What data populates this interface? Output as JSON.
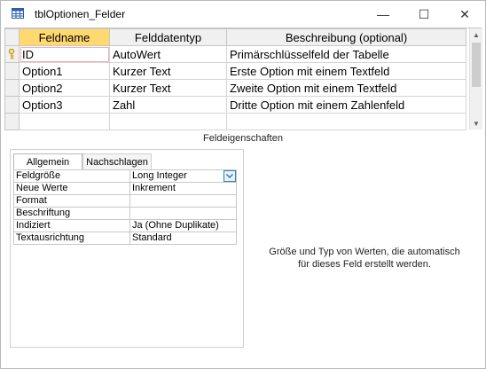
{
  "window": {
    "title": "tblOptionen_Felder",
    "controls": {
      "minimize": "—",
      "maximize": "☐",
      "close": "✕"
    }
  },
  "grid": {
    "headers": [
      "Feldname",
      "Felddatentyp",
      "Beschreibung (optional)"
    ],
    "rows": [
      {
        "name": "ID",
        "type": "AutoWert",
        "description": "Primärschlüsselfeld der Tabelle",
        "key": true
      },
      {
        "name": "Option1",
        "type": "Kurzer Text",
        "description": "Erste Option mit einem Textfeld"
      },
      {
        "name": "Option2",
        "type": "Kurzer Text",
        "description": "Zweite Option mit einem Textfeld"
      },
      {
        "name": "Option3",
        "type": "Zahl",
        "description": "Dritte Option mit einem Zahlenfeld"
      }
    ],
    "accent_color": "#ffd870"
  },
  "properties": {
    "heading": "Feldeigenschaften",
    "tabs": [
      "Allgemein",
      "Nachschlagen"
    ],
    "active_tab": "Allgemein",
    "rows": [
      {
        "label": "Feldgröße",
        "value": "Long Integer",
        "dropdown": true
      },
      {
        "label": "Neue Werte",
        "value": "Inkrement"
      },
      {
        "label": "Format",
        "value": ""
      },
      {
        "label": "Beschriftung",
        "value": ""
      },
      {
        "label": "Indiziert",
        "value": "Ja (Ohne Duplikate)"
      },
      {
        "label": "Textausrichtung",
        "value": "Standard"
      }
    ],
    "help_text_line1": "Größe und Typ von Werten, die automatisch",
    "help_text_line2": "für dieses Feld erstellt werden."
  }
}
